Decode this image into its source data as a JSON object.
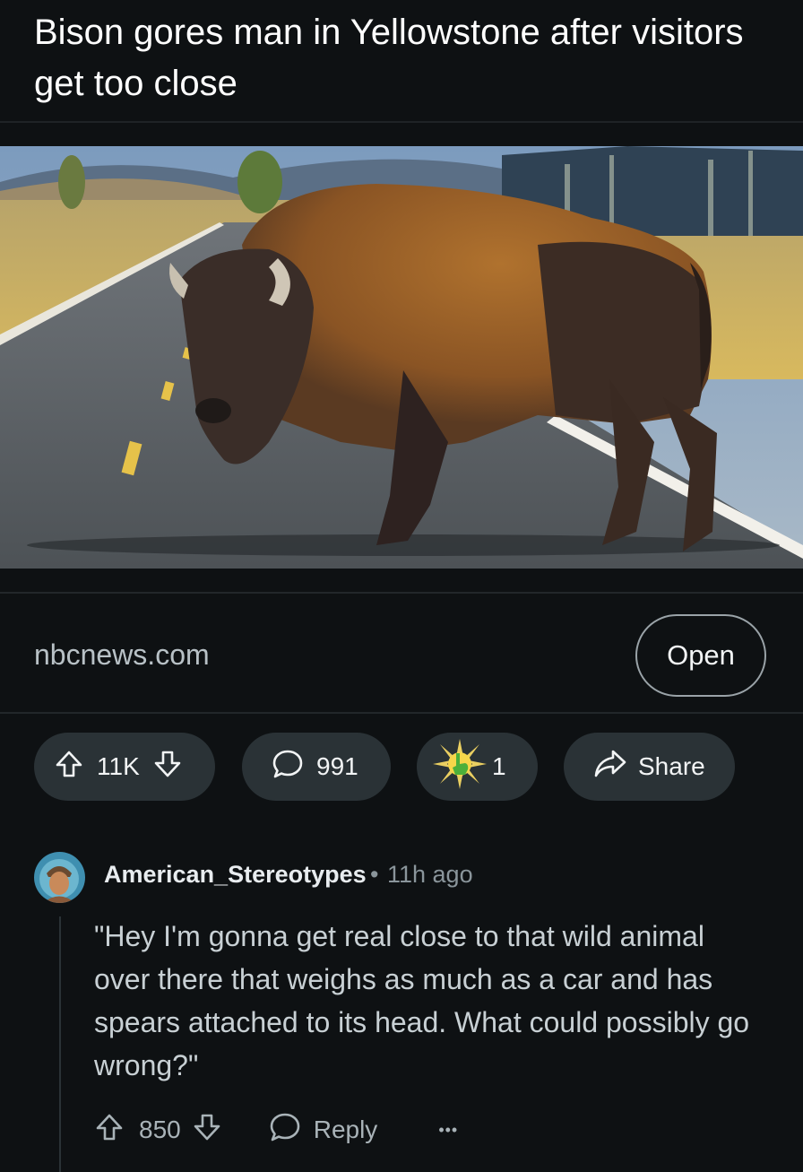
{
  "post": {
    "title": "Bison gores man in Yellowstone after visitors get too close"
  },
  "link": {
    "domain": "nbcnews.com",
    "open_label": "Open"
  },
  "actions": {
    "votes": "11K",
    "comments": "991",
    "awards": "1",
    "share_label": "Share"
  },
  "comment": {
    "author": "American_Stereotypes",
    "separator": "•",
    "age": "11h ago",
    "body": "\"Hey I'm gonna get real close to that wild animal over there that weighs as much as a car and has spears attached to its head. What could possibly go wrong?\"",
    "votes": "850",
    "reply_label": "Reply",
    "more_label": "•••"
  },
  "colors": {
    "background": "#0e1113",
    "pill": "#2a3236",
    "text": "#f2f4f5",
    "muted": "#8a959b"
  }
}
